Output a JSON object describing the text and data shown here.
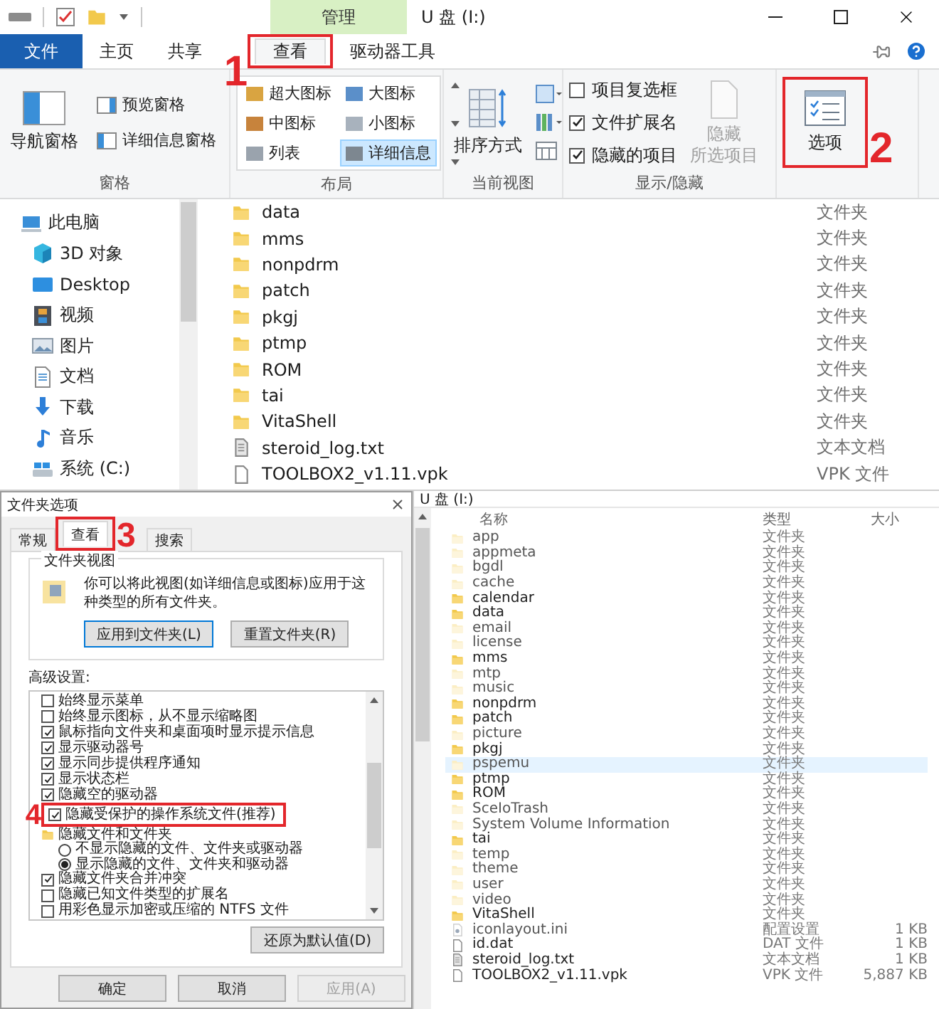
{
  "explorer": {
    "context_tab": "管理",
    "title": "U 盘 (I:)",
    "tabs": [
      {
        "label": "文件",
        "kind": "file",
        "selected": false
      },
      {
        "label": "主页",
        "kind": "tab",
        "selected": false
      },
      {
        "label": "共享",
        "kind": "tab",
        "selected": false
      },
      {
        "label": "查看",
        "kind": "tab",
        "selected": true,
        "marker": {
          "number": "1"
        }
      },
      {
        "label": "驱动器工具",
        "kind": "tab",
        "selected": false
      }
    ],
    "ribbon": {
      "panes": {
        "label": "窗格",
        "nav_pane": "导航窗格",
        "buttons": [
          "预览窗格",
          "详细信息窗格"
        ]
      },
      "layout": {
        "label": "布局",
        "options": [
          {
            "label": "超大图标",
            "selected": false
          },
          {
            "label": "大图标",
            "selected": false
          },
          {
            "label": "中图标",
            "selected": false
          },
          {
            "label": "小图标",
            "selected": false
          },
          {
            "label": "列表",
            "selected": false
          },
          {
            "label": "详细信息",
            "selected": true
          }
        ]
      },
      "current_view": {
        "label": "当前视图",
        "sort": "排序方式"
      },
      "show_hide": {
        "label": "显示/隐藏",
        "checkboxes": [
          {
            "label": "项目复选框",
            "checked": false
          },
          {
            "label": "文件扩展名",
            "checked": true
          },
          {
            "label": "隐藏的项目",
            "checked": true
          }
        ],
        "hide_selected": {
          "lines": [
            "隐藏",
            "所选项目"
          ],
          "disabled": true
        }
      },
      "options": {
        "label": "选项",
        "marker": {
          "number": "2"
        }
      }
    },
    "nav": [
      {
        "label": "此电脑",
        "kind": "pc"
      },
      {
        "label": "3D 对象",
        "kind": "cube"
      },
      {
        "label": "Desktop",
        "kind": "desktop"
      },
      {
        "label": "视频",
        "kind": "video"
      },
      {
        "label": "图片",
        "kind": "picture"
      },
      {
        "label": "文档",
        "kind": "document"
      },
      {
        "label": "下载",
        "kind": "download"
      },
      {
        "label": "音乐",
        "kind": "music"
      },
      {
        "label": "系统 (C:)",
        "kind": "drive"
      }
    ],
    "files": [
      {
        "name": "data",
        "type": "文件夹",
        "kind": "folder"
      },
      {
        "name": "mms",
        "type": "文件夹",
        "kind": "folder"
      },
      {
        "name": "nonpdrm",
        "type": "文件夹",
        "kind": "folder"
      },
      {
        "name": "patch",
        "type": "文件夹",
        "kind": "folder"
      },
      {
        "name": "pkgj",
        "type": "文件夹",
        "kind": "folder"
      },
      {
        "name": "ptmp",
        "type": "文件夹",
        "kind": "folder"
      },
      {
        "name": "ROM",
        "type": "文件夹",
        "kind": "folder"
      },
      {
        "name": "tai",
        "type": "文件夹",
        "kind": "folder"
      },
      {
        "name": "VitaShell",
        "type": "文件夹",
        "kind": "folder"
      },
      {
        "name": "steroid_log.txt",
        "type": "文本文档",
        "kind": "text"
      },
      {
        "name": "TOOLBOX2_v1.11.vpk",
        "type": "VPK 文件",
        "kind": "file"
      }
    ]
  },
  "folder_options": {
    "title": "文件夹选项",
    "tabs": [
      {
        "label": "常规",
        "selected": false
      },
      {
        "label": "查看",
        "selected": true,
        "marker": {
          "number": "3"
        }
      },
      {
        "label": "搜索",
        "selected": false
      }
    ],
    "folder_views": {
      "legend": "文件夹视图",
      "description": "你可以将此视图(如详细信息或图标)应用于这种类型的所有文件夹。",
      "buttons": [
        {
          "label": "应用到文件夹(L)",
          "focused": true
        },
        {
          "label": "重置文件夹(R)",
          "focused": false
        }
      ]
    },
    "advanced_label": "高级设置:",
    "settings": [
      {
        "kind": "checkbox",
        "label": "始终显示菜单",
        "checked": false
      },
      {
        "kind": "checkbox",
        "label": "始终显示图标，从不显示缩略图",
        "checked": false
      },
      {
        "kind": "checkbox",
        "label": "鼠标指向文件夹和桌面项时显示提示信息",
        "checked": true
      },
      {
        "kind": "checkbox",
        "label": "显示驱动器号",
        "checked": true
      },
      {
        "kind": "checkbox",
        "label": "显示同步提供程序通知",
        "checked": true
      },
      {
        "kind": "checkbox",
        "label": "显示状态栏",
        "checked": true
      },
      {
        "kind": "checkbox",
        "label": "隐藏空的驱动器",
        "checked": true
      },
      {
        "kind": "checkbox",
        "label": "隐藏受保护的操作系统文件(推荐)",
        "checked": true,
        "marker": {
          "number": "4"
        }
      },
      {
        "kind": "folder",
        "label": "隐藏文件和文件夹",
        "children": [
          {
            "kind": "radio",
            "label": "不显示隐藏的文件、文件夹或驱动器",
            "selected": false
          },
          {
            "kind": "radio",
            "label": "显示隐藏的文件、文件夹和驱动器",
            "selected": true
          }
        ]
      },
      {
        "kind": "checkbox",
        "label": "隐藏文件夹合并冲突",
        "checked": true
      },
      {
        "kind": "checkbox",
        "label": "隐藏已知文件类型的扩展名",
        "checked": false
      },
      {
        "kind": "checkbox",
        "label": "用彩色显示加密或压缩的 NTFS 文件",
        "checked": false
      }
    ],
    "restore_button": "还原为默认值(D)",
    "footer_buttons": [
      {
        "label": "确定",
        "disabled": false
      },
      {
        "label": "取消",
        "disabled": false
      },
      {
        "label": "应用(A)",
        "disabled": true
      }
    ]
  },
  "small_explorer": {
    "title": "U 盘 (I:)",
    "columns": [
      "名称",
      "类型",
      "大小"
    ],
    "rows": [
      {
        "name": "app",
        "type": "文件夹",
        "kind": "folder",
        "hidden": true,
        "selected": false
      },
      {
        "name": "appmeta",
        "type": "文件夹",
        "kind": "folder",
        "hidden": true,
        "selected": false
      },
      {
        "name": "bgdl",
        "type": "文件夹",
        "kind": "folder",
        "hidden": true,
        "selected": false
      },
      {
        "name": "cache",
        "type": "文件夹",
        "kind": "folder",
        "hidden": true,
        "selected": false
      },
      {
        "name": "calendar",
        "type": "文件夹",
        "kind": "folder",
        "hidden": false,
        "selected": false
      },
      {
        "name": "data",
        "type": "文件夹",
        "kind": "folder",
        "hidden": false,
        "selected": false
      },
      {
        "name": "email",
        "type": "文件夹",
        "kind": "folder",
        "hidden": true,
        "selected": false
      },
      {
        "name": "license",
        "type": "文件夹",
        "kind": "folder",
        "hidden": true,
        "selected": false
      },
      {
        "name": "mms",
        "type": "文件夹",
        "kind": "folder",
        "hidden": false,
        "selected": false
      },
      {
        "name": "mtp",
        "type": "文件夹",
        "kind": "folder",
        "hidden": true,
        "selected": false
      },
      {
        "name": "music",
        "type": "文件夹",
        "kind": "folder",
        "hidden": true,
        "selected": false
      },
      {
        "name": "nonpdrm",
        "type": "文件夹",
        "kind": "folder",
        "hidden": false,
        "selected": false
      },
      {
        "name": "patch",
        "type": "文件夹",
        "kind": "folder",
        "hidden": false,
        "selected": false
      },
      {
        "name": "picture",
        "type": "文件夹",
        "kind": "folder",
        "hidden": true,
        "selected": false
      },
      {
        "name": "pkgj",
        "type": "文件夹",
        "kind": "folder",
        "hidden": false,
        "selected": false
      },
      {
        "name": "pspemu",
        "type": "文件夹",
        "kind": "folder",
        "hidden": true,
        "selected": true
      },
      {
        "name": "ptmp",
        "type": "文件夹",
        "kind": "folder",
        "hidden": false,
        "selected": false
      },
      {
        "name": "ROM",
        "type": "文件夹",
        "kind": "folder",
        "hidden": false,
        "selected": false
      },
      {
        "name": "SceIoTrash",
        "type": "文件夹",
        "kind": "folder",
        "hidden": true,
        "selected": false
      },
      {
        "name": "System Volume Information",
        "type": "文件夹",
        "kind": "folder",
        "hidden": true,
        "selected": false
      },
      {
        "name": "tai",
        "type": "文件夹",
        "kind": "folder",
        "hidden": false,
        "selected": false
      },
      {
        "name": "temp",
        "type": "文件夹",
        "kind": "folder",
        "hidden": true,
        "selected": false
      },
      {
        "name": "theme",
        "type": "文件夹",
        "kind": "folder",
        "hidden": true,
        "selected": false
      },
      {
        "name": "user",
        "type": "文件夹",
        "kind": "folder",
        "hidden": true,
        "selected": false
      },
      {
        "name": "video",
        "type": "文件夹",
        "kind": "folder",
        "hidden": true,
        "selected": false
      },
      {
        "name": "VitaShell",
        "type": "文件夹",
        "kind": "folder",
        "hidden": false,
        "selected": false
      },
      {
        "name": "iconlayout.ini",
        "type": "配置设置",
        "size": "1 KB",
        "kind": "ini",
        "hidden": true,
        "selected": false
      },
      {
        "name": "id.dat",
        "type": "DAT 文件",
        "size": "1 KB",
        "kind": "file",
        "hidden": false,
        "selected": false
      },
      {
        "name": "steroid_log.txt",
        "type": "文本文档",
        "size": "1 KB",
        "kind": "text",
        "hidden": false,
        "selected": false
      },
      {
        "name": "TOOLBOX2_v1.11.vpk",
        "type": "VPK 文件",
        "size": "5,887 KB",
        "kind": "file",
        "hidden": false,
        "selected": false
      }
    ]
  }
}
